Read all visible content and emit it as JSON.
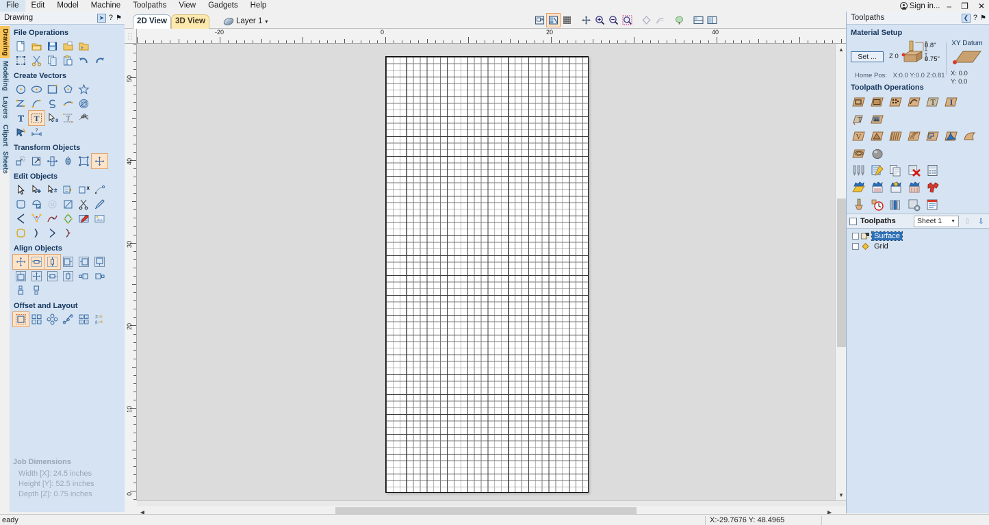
{
  "window": {
    "signin_label": "Sign in...",
    "minimize": "–",
    "restore": "❐",
    "close": "✕"
  },
  "menubar": {
    "items": [
      {
        "label": "File"
      },
      {
        "label": "Edit"
      },
      {
        "label": "Model"
      },
      {
        "label": "Machine"
      },
      {
        "label": "Toolpaths"
      },
      {
        "label": "View"
      },
      {
        "label": "Gadgets"
      },
      {
        "label": "Help"
      }
    ]
  },
  "side_tabs": [
    {
      "label": "Drawing",
      "active": true
    },
    {
      "label": "Modeling",
      "active": false
    },
    {
      "label": "Layers",
      "active": false
    },
    {
      "label": "Clipart",
      "active": false
    },
    {
      "label": "Sheets",
      "active": false
    }
  ],
  "drawing_panel": {
    "title": "Drawing",
    "help_label": "?",
    "pin_label": "⚑",
    "groups": [
      {
        "title": "File Operations",
        "rows": [
          [
            "new-file-icon",
            "open-file-icon",
            "save-file-icon",
            "import-file-icon",
            "open-folder-icon"
          ],
          [
            "select-all-icon",
            "cut-icon",
            "copy-icon",
            "paste-icon",
            "undo-icon",
            "redo-icon"
          ]
        ]
      },
      {
        "title": "Create Vectors",
        "rows": [
          [
            "circle-icon",
            "ellipse-icon",
            "rectangle-icon",
            "polygon-icon",
            "star-icon"
          ],
          [
            "polyline-icon",
            "curve-icon",
            "spiral-icon",
            "arc-icon",
            "weave-icon"
          ],
          [
            "text-icon",
            "text-box-icon",
            "text-select-icon",
            "text-on-curve-icon",
            "text-arc-icon"
          ],
          [
            "trace-bitmap-icon",
            "dimension-icon"
          ]
        ]
      },
      {
        "title": "Transform Objects",
        "rows": [
          [
            "move-icon",
            "scale-icon",
            "rotate-icon",
            "mirror-icon",
            "distort-icon",
            "align-center-icon"
          ]
        ]
      },
      {
        "title": "Edit Objects",
        "rows": [
          [
            "node-edit-icon",
            "node-add-icon",
            "node-move-icon",
            "group-icon",
            "ungroup-icon",
            "join-icon"
          ],
          [
            "weld-icon",
            "subtract-icon",
            "intersect-icon",
            "clip-icon",
            "trim-icon",
            "paintbrush-icon"
          ],
          [
            "fillet-icon",
            "nodes-icon",
            "smooth-curve-icon",
            "offset-shape-icon",
            "bitmap-fit-icon",
            "image-icon"
          ],
          [
            "inlay-icon",
            "curve-fit-icon",
            "arc-fit-icon",
            "node-array-icon"
          ]
        ]
      },
      {
        "title": "Align Objects",
        "rows": [
          [
            "align-center-both-icon",
            "align-center-horizontal-icon",
            "align-center-vertical-icon",
            "align-left-icon",
            "align-right-icon",
            "align-top-icon"
          ],
          [
            "align-bottom-icon",
            "align-page-center-icon",
            "align-page-horizontal-icon",
            "align-page-vertical-icon",
            "align-outside-left-icon",
            "align-outside-right-icon"
          ],
          [
            "align-above-icon",
            "align-below-icon"
          ]
        ]
      },
      {
        "title": "Offset and Layout",
        "rows": [
          [
            "offset-icon",
            "array-copy-icon",
            "circular-array-icon",
            "copy-along-curve-icon",
            "nesting-icon",
            "text-layout-icon"
          ]
        ]
      }
    ],
    "job_dimensions": {
      "title": "Job Dimensions",
      "width": "Width  [X]: 24.5 inches",
      "height": "Height [Y]: 52.5 inches",
      "depth": "Depth  [Z]: 0.75 inches"
    }
  },
  "view_bar": {
    "tabs": [
      {
        "label": "2D View",
        "active": true
      },
      {
        "label": "3D View",
        "active": false
      }
    ],
    "layer_label": "Layer 1",
    "layer_caret": "▾",
    "tools": [
      "zoom-extents-icon",
      "zoom-to-job-icon",
      "toggle-grid-icon",
      "pan-icon",
      "zoom-in-icon",
      "zoom-out-icon",
      "zoom-selection-icon",
      "show-vectors-icon",
      "show-hidden-vectors-icon",
      "show-model-icon",
      "split-view-horizontal-icon",
      "split-view-vertical-icon"
    ]
  },
  "rulers": {
    "horizontal": {
      "labels": [
        {
          "text": "-20",
          "value": -20
        },
        {
          "text": "0",
          "value": 0
        },
        {
          "text": "20",
          "value": 20
        },
        {
          "text": "40",
          "value": 40
        }
      ],
      "units": "inches"
    },
    "vertical": {
      "labels": [
        {
          "text": "50",
          "value": 50
        },
        {
          "text": "40",
          "value": 40
        },
        {
          "text": "30",
          "value": 30
        },
        {
          "text": "20",
          "value": 20
        },
        {
          "text": "10",
          "value": 10
        },
        {
          "text": "0",
          "value": 0
        }
      ],
      "units": "inches"
    }
  },
  "canvas": {
    "material_width_in": 24.5,
    "material_height_in": 52.5,
    "grid_major_every": 3,
    "grid_minor_cells_x": 30,
    "grid_minor_cells_y": 66,
    "sheet_fill": "#ffffff",
    "background": "#dcdcdc"
  },
  "toolpaths_panel": {
    "title": "Toolpaths",
    "help_label": "?",
    "pin_label": "⚑",
    "material_setup": {
      "title": "Material Setup",
      "set_button": "Set ...",
      "z_zero_label": "Z 0",
      "thickness_above": "0.8\"",
      "thickness_below": "0.75\"",
      "home_pos_label": "Home Pos:",
      "home_pos_value": "X:0.0 Y:0.0 Z:0.81"
    },
    "xy_datum": {
      "title": "XY Datum",
      "x": "X: 0.0",
      "y": "Y: 0.0"
    },
    "operations": {
      "title": "Toolpath Operations",
      "rows": [
        [
          "profile-toolpath-icon",
          "pocket-toolpath-icon",
          "drilling-toolpath-icon",
          "fluting-toolpath-icon",
          "vcarve-text-icon",
          "inlay-text-icon"
        ],
        [
          "text-toolpath-icon",
          "photo-vcarve-icon"
        ],
        [
          "vcarve-toolpath-icon",
          "prism-carving-icon",
          "moulding-toolpath-icon",
          "fluting-3d-icon",
          "chamfer-toolpath-icon",
          "3d-rough-icon",
          "3d-finish-icon"
        ],
        [
          "machine-along-vector-icon",
          "3d-ball-icon"
        ],
        [
          "tool-database-icon",
          "edit-toolpath-icon",
          "duplicate-toolpath-icon",
          "delete-toolpath-icon",
          "toolpath-summary-icon"
        ],
        [
          "preview-toolpath-icon",
          "save-toolpath-icon",
          "add-toolpath-icon",
          "group-toolpaths-icon",
          "simulate-icon"
        ],
        [
          "material-block-icon",
          "estimate-time-icon",
          "toolpath-list-icon",
          "toolpath-settings-icon",
          "sheet-layout-icon"
        ]
      ]
    },
    "toolpath_list": {
      "header_label": "Toolpaths",
      "sheet_selector": "Sheet 1",
      "move_up_label": "⇧",
      "move_down_label": "⇩",
      "items": [
        {
          "name": "Surface",
          "selected": true,
          "checked": false,
          "icon": "toolpath-item-icon"
        },
        {
          "name": "Grid",
          "selected": false,
          "checked": false,
          "icon": "toolpath-diamond-icon"
        }
      ]
    }
  },
  "status_bar": {
    "message": "eady",
    "coordinates": "X:-29.7676 Y: 48.4965"
  },
  "colors": {
    "panel_bg": "#d5e3f2",
    "group_title": "#17375e",
    "active_tab": "#fbc55a",
    "canvas_bg": "#dcdcdc",
    "selection_blue": "#2f6fb5"
  }
}
